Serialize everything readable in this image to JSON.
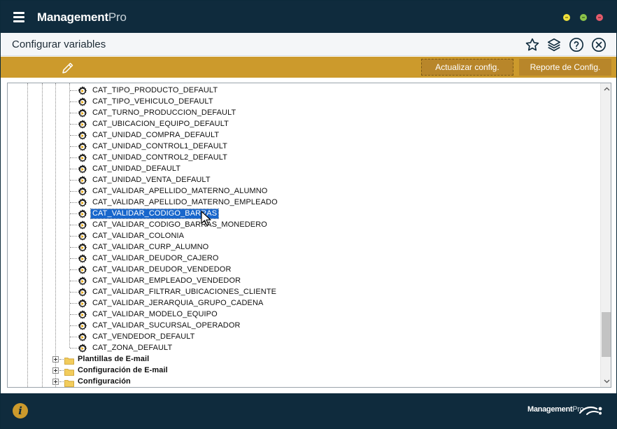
{
  "app": {
    "title_bold": "Management",
    "title_thin": "Pro",
    "window_colors": {
      "minimize": "#f0e03a",
      "maximize": "#8bc34a",
      "close": "#e45b6b"
    }
  },
  "header": {
    "title": "Configurar variables",
    "icons": [
      "star-icon",
      "layers-icon",
      "help-icon",
      "close-circle-icon"
    ]
  },
  "toolbar": {
    "edit_icon": "pencil-icon",
    "update_label": "Actualizar config.",
    "report_label": "Reporte de Config."
  },
  "tree": {
    "variables": [
      "CAT_TIPO_PRODUCTO_DEFAULT",
      "CAT_TIPO_VEHICULO_DEFAULT",
      "CAT_TURNO_PRODUCCION_DEFAULT",
      "CAT_UBICACION_EQUIPO_DEFAULT",
      "CAT_UNIDAD_COMPRA_DEFAULT",
      "CAT_UNIDAD_CONTROL1_DEFAULT",
      "CAT_UNIDAD_CONTROL2_DEFAULT",
      "CAT_UNIDAD_DEFAULT",
      "CAT_UNIDAD_VENTA_DEFAULT",
      "CAT_VALIDAR_APELLIDO_MATERNO_ALUMNO",
      "CAT_VALIDAR_APELLIDO_MATERNO_EMPLEADO",
      "CAT_VALIDAR_CODIGO_BARRAS",
      "CAT_VALIDAR_CODIGO_BARRAS_MONEDERO",
      "CAT_VALIDAR_COLONIA",
      "CAT_VALIDAR_CURP_ALUMNO",
      "CAT_VALIDAR_DEUDOR_CAJERO",
      "CAT_VALIDAR_DEUDOR_VENDEDOR",
      "CAT_VALIDAR_EMPLEADO_VENDEDOR",
      "CAT_VALIDAR_FILTRAR_UBICACIONES_CLIENTE",
      "CAT_VALIDAR_JERARQUIA_GRUPO_CADENA",
      "CAT_VALIDAR_MODELO_EQUIPO",
      "CAT_VALIDAR_SUCURSAL_OPERADOR",
      "CAT_VENDEDOR_DEFAULT",
      "CAT_ZONA_DEFAULT"
    ],
    "selected_index": 11,
    "folders": [
      "Plantillas de E-mail",
      "Configuración de E-mail",
      "Configuración"
    ]
  },
  "footer": {
    "info_icon": "info-icon",
    "brand_bold": "Management",
    "brand_thin": "Pro"
  }
}
